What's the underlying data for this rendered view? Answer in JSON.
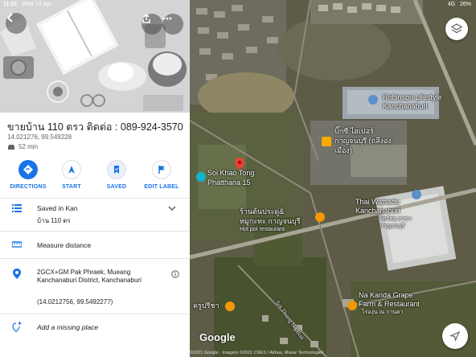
{
  "status_bar": {
    "time": "11:51",
    "date": "Wed 14 Apr",
    "network": "4G",
    "battery": "26%"
  },
  "place": {
    "title": "ขายบ้าน 110 ตรว ติดต่อ : 089-924-3570",
    "coords": "14.021276, 99.549228",
    "drive_time": "52 min"
  },
  "actions": [
    {
      "label": "DIRECTIONS",
      "icon": "directions-icon"
    },
    {
      "label": "START",
      "icon": "navigation-icon"
    },
    {
      "label": "SAVED",
      "icon": "bookmark-icon"
    },
    {
      "label": "EDIT LABEL",
      "icon": "flag-icon"
    }
  ],
  "rows": {
    "saved_title": "Saved in Kan",
    "saved_sub": "บ้าน 110 ตร",
    "measure": "Measure distance",
    "address_line1": "2GCX+GM Pak Phraek, Mueang",
    "address_line2": "Kanchanaburi District, Kanchanaburi",
    "coordinates": "(14.0212756, 99.5492277)",
    "add_place": "Add a missing place"
  },
  "map": {
    "labels": {
      "robinson_1": "Robinson Lifestyle",
      "robinson_2": "Kanchanaburi",
      "bigc_1": "บิ๊กซี ไฮเปอร์",
      "bigc_2": "กาญจนบุรี (ถลึงอง",
      "bigc_3": "เมือง)",
      "soi_1": "Soi Khao Tong",
      "soi_2": "Phatthana 15",
      "shop_1": "ร้านต้นประดู่&",
      "shop_2": "หมูกะทะ กาญจนบุรี",
      "shop_3": "Hot pot restaurant",
      "watsadu_1": "Thai Watsadu",
      "watsadu_2": "Kanchanaburi",
      "watsadu_3": "ไทวัสดุ สาขา",
      "watsadu_4": "กาญจนบุรี",
      "nakanda_1": "Na Kanda Grape",
      "nakanda_2": "Farm & Restaurant",
      "nakanda_3": "ไร่องุ่น ณ กานดา",
      "kru": "ครูปรีชา",
      "road": "Soi Thung Na Bua"
    },
    "logo": "Google",
    "attribution": "©2021 Google · Imagery ©2021 CNES / Airbus, Maxar Technologies"
  },
  "colors": {
    "accent": "#1a73e8",
    "pin": "#ea4335",
    "poi_orange": "#f29900",
    "poi_teal": "#12b5cb"
  }
}
